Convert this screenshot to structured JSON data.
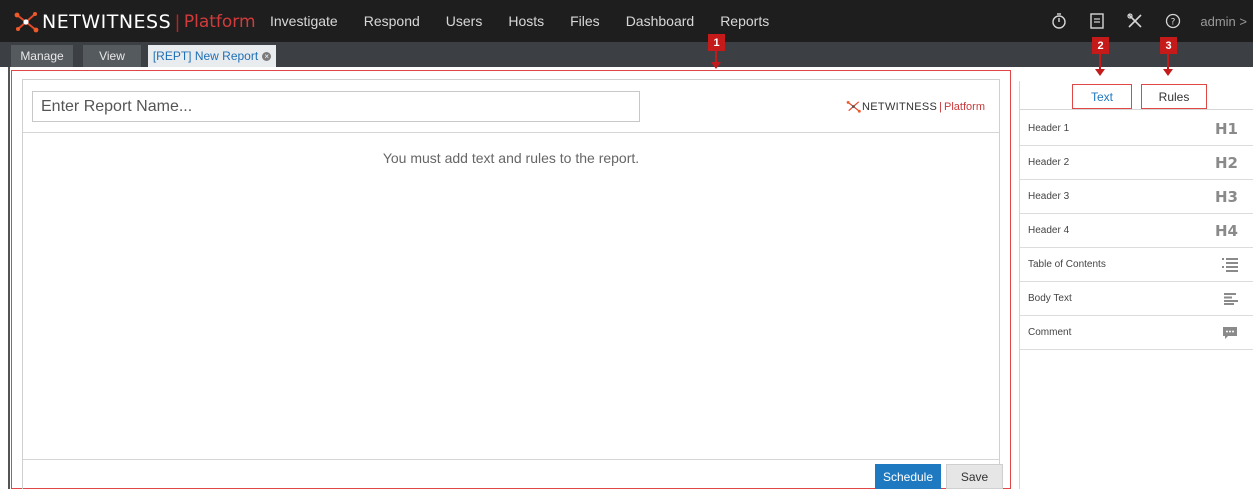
{
  "brand": {
    "name": "NETWITNESS",
    "separator": "|",
    "product": "Platform"
  },
  "nav": {
    "items": [
      "Investigate",
      "Respond",
      "Users",
      "Hosts",
      "Files",
      "Dashboard",
      "Reports"
    ]
  },
  "toolbar": {
    "user_label": "admin >"
  },
  "tabs": {
    "manage": "Manage",
    "view": "View",
    "report": "[REPT] New Report"
  },
  "editor": {
    "name_placeholder": "Enter Report Name...",
    "brand_name": "NETWITNESS",
    "brand_separator": "|",
    "brand_product": "Platform",
    "empty_message": "You must add text and rules to the report.",
    "schedule_label": "Schedule",
    "save_label": "Save"
  },
  "callouts": {
    "one": "1",
    "two": "2",
    "three": "3"
  },
  "panel": {
    "tab_text": "Text",
    "tab_rules": "Rules",
    "items": [
      {
        "label": "Header 1",
        "icon": "H1"
      },
      {
        "label": "Header 2",
        "icon": "H2"
      },
      {
        "label": "Header 3",
        "icon": "H3"
      },
      {
        "label": "Header 4",
        "icon": "H4"
      },
      {
        "label": "Table of Contents",
        "icon": "table-of-contents-icon"
      },
      {
        "label": "Body Text",
        "icon": "body-text-icon"
      },
      {
        "label": "Comment",
        "icon": "comment-icon"
      }
    ]
  },
  "colors": {
    "topbar": "#1e1e1e",
    "brand_red": "#d23b3b",
    "accent_blue": "#1f79c0",
    "callout_red": "#c41a1a"
  }
}
